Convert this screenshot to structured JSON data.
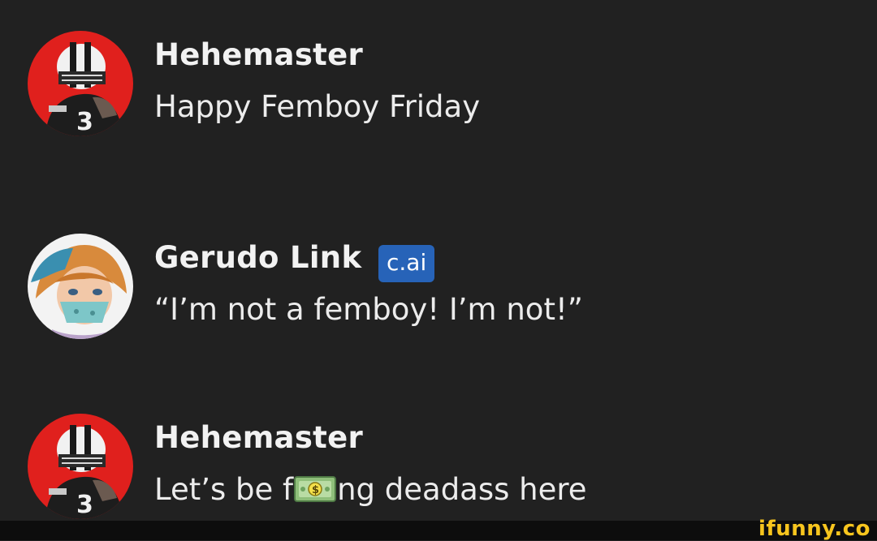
{
  "messages": [
    {
      "author": "Hehemaster",
      "avatar_icon": "football-player-avatar-icon",
      "text": "Happy Femboy Friday"
    },
    {
      "author": "Gerudo Link",
      "badge": "c.ai",
      "avatar_icon": "gerudo-link-avatar-icon",
      "text": "“I’m not a femboy! I’m not!”"
    },
    {
      "author": "Hehemaster",
      "avatar_icon": "football-player-avatar-icon",
      "text_before": "Let’s be f",
      "emoji": "money-bill-emoji",
      "text_after": "ng deadass here"
    }
  ],
  "watermark": "ifunny.co",
  "colors": {
    "background": "#212121",
    "badge": "#2763b8",
    "watermark": "#f7c51e",
    "avatar_red": "#e0201d"
  }
}
